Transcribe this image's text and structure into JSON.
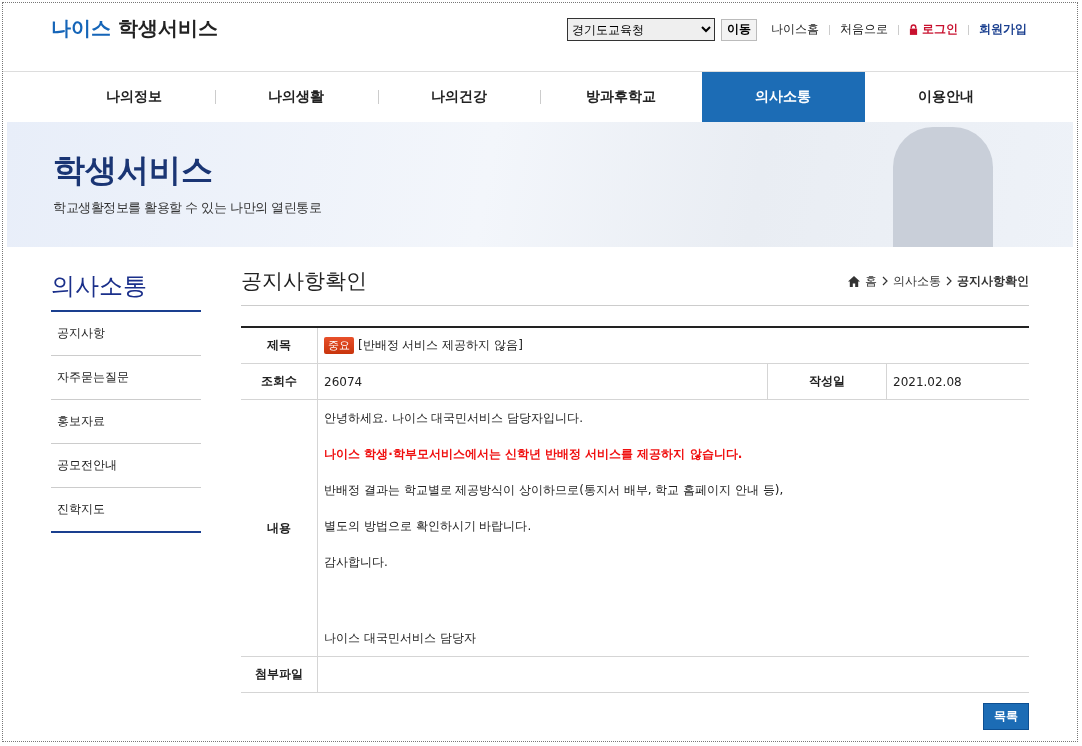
{
  "header": {
    "logo": {
      "brand": "나이스",
      "service": "학생서비스"
    },
    "region_select": {
      "value": "경기도교육청"
    },
    "go_button": "이동",
    "links": [
      {
        "label": "나이스홈",
        "kind": "plain"
      },
      {
        "label": "처음으로",
        "kind": "plain"
      },
      {
        "label": "로그인",
        "kind": "login"
      },
      {
        "label": "회원가입",
        "kind": "join"
      }
    ]
  },
  "nav": [
    {
      "label": "나의정보",
      "selected": false
    },
    {
      "label": "나의생활",
      "selected": false
    },
    {
      "label": "나의건강",
      "selected": false
    },
    {
      "label": "방과후학교",
      "selected": false
    },
    {
      "label": "의사소통",
      "selected": true
    },
    {
      "label": "이용안내",
      "selected": false
    }
  ],
  "banner": {
    "title": "학생서비스",
    "subtitle": "학교생활정보를 활용할 수 있는 나만의 열린통로"
  },
  "sidebar": {
    "title": "의사소통",
    "items": [
      "공지사항",
      "자주묻는질문",
      "홍보자료",
      "공모전안내",
      "진학지도"
    ]
  },
  "page_title": "공지사항확인",
  "breadcrumb": [
    "홈",
    "의사소통",
    "공지사항확인"
  ],
  "notice": {
    "subject_label": "제목",
    "badge": "중요",
    "subject": "[반배정 서비스 제공하지 않음]",
    "views_label": "조회수",
    "views": "26074",
    "date_label": "작성일",
    "date": "2021.02.08",
    "content_label": "내용",
    "content": [
      {
        "kind": "normal",
        "text": "안녕하세요. 나이스 대국민서비스 담당자입니다."
      },
      {
        "kind": "emphasis",
        "text": "나이스 학생·학부모서비스에서는 신학년 반배정 서비스를 제공하지 않습니다."
      },
      {
        "kind": "normal",
        "text": "반배정 결과는 학교별로 제공방식이 상이하므로(통지서 배부, 학교 홈페이지 안내 등),"
      },
      {
        "kind": "normal",
        "text": "별도의 방법으로 확인하시기 바랍니다."
      },
      {
        "kind": "normal",
        "text": "감사합니다."
      },
      {
        "kind": "signature",
        "text": "나이스 대국민서비스 담당자"
      }
    ],
    "attachment_label": "첨부파일"
  },
  "list_button": "목록"
}
